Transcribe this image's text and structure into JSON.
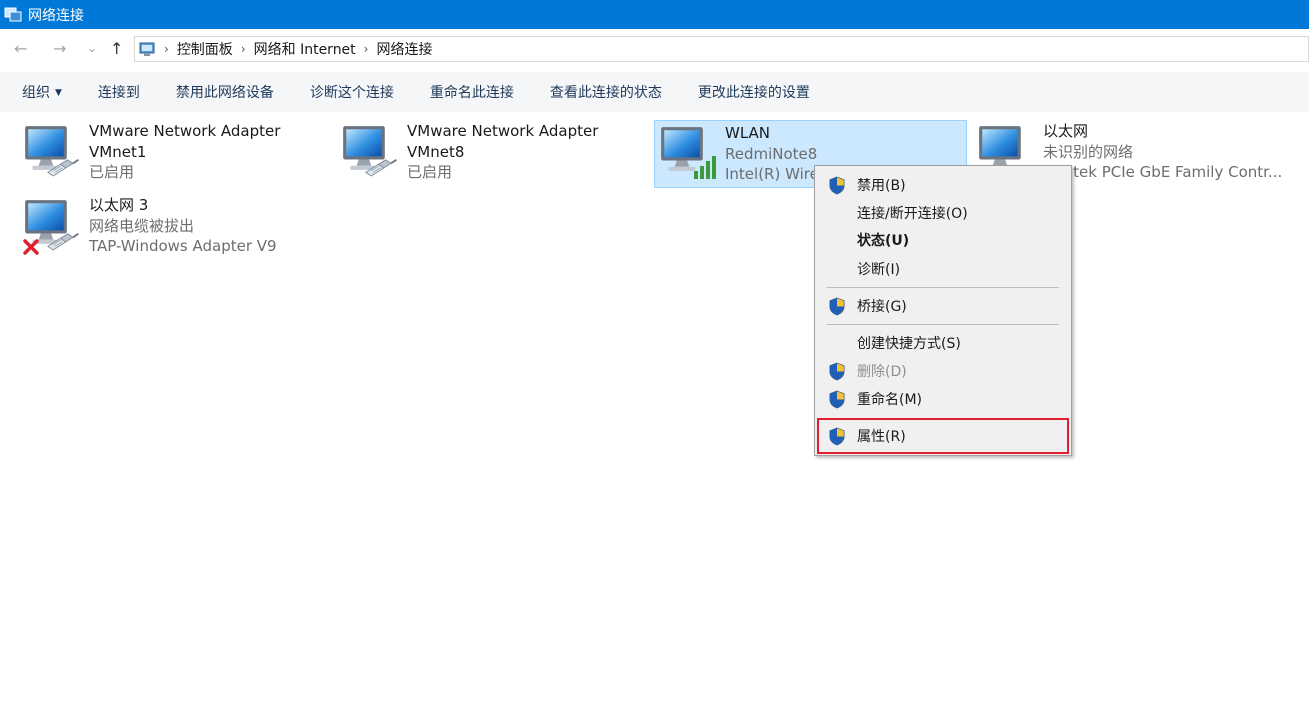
{
  "window": {
    "title": "网络连接"
  },
  "nav": {
    "back_icon": "←",
    "forward_icon": "→",
    "dropdown_icon": "⌄",
    "up_icon": "↑"
  },
  "breadcrumb": [
    "控制面板",
    "网络和 Internet",
    "网络连接"
  ],
  "breadcrumb_sep": "›",
  "toolbar": {
    "items": [
      "组织",
      "连接到",
      "禁用此网络设备",
      "诊断这个连接",
      "重命名此连接",
      "查看此连接的状态",
      "更改此连接的设置"
    ],
    "organize_caret": "▼"
  },
  "connections": [
    {
      "name": "VMware Network Adapter VMnet1",
      "name_line1": "VMware Network Adapter",
      "name_line2": "VMnet1",
      "status": "已启用",
      "type": "ethernet"
    },
    {
      "name": "VMware Network Adapter VMnet8",
      "name_line1": "VMware Network Adapter",
      "name_line2": "VMnet8",
      "status": "已启用",
      "type": "ethernet"
    },
    {
      "name": "WLAN",
      "network": "RedmiNote8",
      "device": "Intel(R) Wire",
      "type": "wifi",
      "selected": true
    },
    {
      "name": "以太网",
      "network": "未识别的网络",
      "device": "ltek PCIe GbE Family Contr...",
      "type": "ethernet"
    },
    {
      "name": "以太网 3",
      "network": "网络电缆被拔出",
      "device": "TAP-Windows Adapter V9",
      "type": "ethernet-disconnected"
    }
  ],
  "context_menu": {
    "items": [
      {
        "label": "禁用(B)",
        "shield": true
      },
      {
        "label": "连接/断开连接(O)",
        "shield": false
      },
      {
        "label": "状态(U)",
        "shield": false,
        "bold": true
      },
      {
        "label": "诊断(I)",
        "shield": false
      },
      {
        "label": "桥接(G)",
        "shield": true
      },
      {
        "label": "创建快捷方式(S)",
        "shield": false
      },
      {
        "label": "删除(D)",
        "shield": true,
        "disabled": true
      },
      {
        "label": "重命名(M)",
        "shield": true
      },
      {
        "label": "属性(R)",
        "shield": true,
        "highlighted": true
      }
    ],
    "highlight_color": "#e0202e"
  },
  "colors": {
    "titlebar": "#0078d7",
    "selection": "#cce8ff",
    "selection_border": "#99d1ff"
  }
}
